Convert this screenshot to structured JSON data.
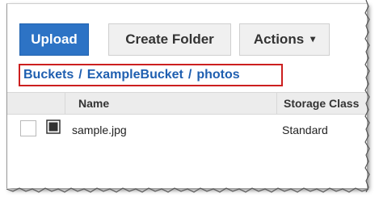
{
  "toolbar": {
    "upload_label": "Upload",
    "create_folder_label": "Create Folder",
    "actions_label": "Actions"
  },
  "breadcrumb": {
    "items": [
      "Buckets",
      "ExampleBucket",
      "photos"
    ],
    "separator": "/"
  },
  "table": {
    "columns": [
      "Name",
      "Storage Class"
    ],
    "rows": [
      {
        "name": "sample.jpg",
        "storage_class": "Standard"
      }
    ]
  },
  "colors": {
    "primary_button": "#2d73c5",
    "breadcrumb_highlight": "#cc1f1f",
    "link": "#1f5fb0"
  },
  "icons": {
    "actions_caret": "chevron-down-icon",
    "file": "file-icon"
  }
}
